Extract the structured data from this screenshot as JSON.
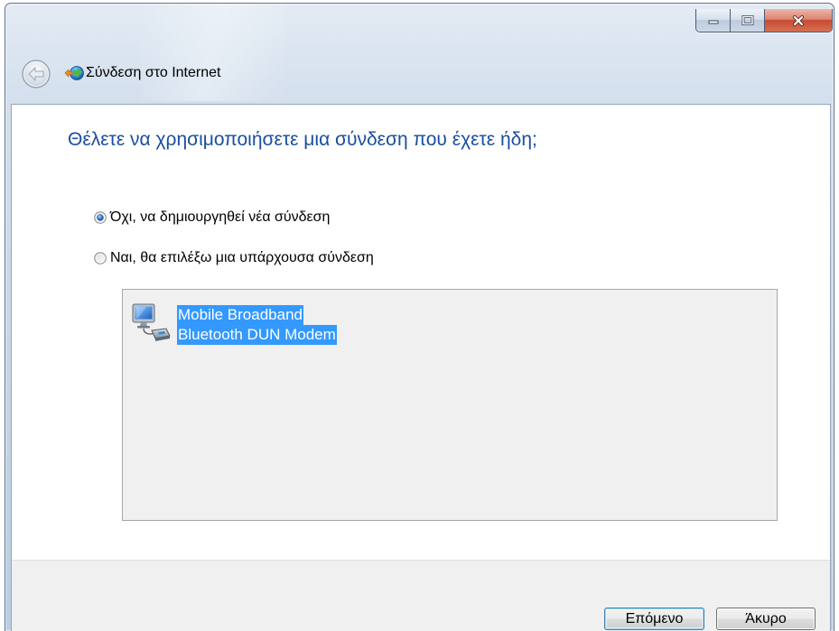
{
  "window": {
    "title": "Σύνδεση στο Internet",
    "app_icon": "connect-internet-icon",
    "back_icon": "back-arrow-icon",
    "controls": {
      "minimize_icon": "minimize-icon",
      "maximize_icon": "maximize-icon",
      "close_icon": "close-icon"
    }
  },
  "main": {
    "heading": "Θέλετε να χρησιμοποιήσετε μια σύνδεση που έχετε ήδη;",
    "options": [
      {
        "label": "Όχι, να δημιουργηθεί νέα σύνδεση",
        "checked": true
      },
      {
        "label": "Ναι, θα επιλέξω μια υπάρχουσα σύνδεση",
        "checked": false
      }
    ],
    "connections": [
      {
        "label_lines": [
          "Mobile Broadband",
          "Bluetooth DUN Modem"
        ],
        "icon": "mobile-broadband-icon",
        "selected": true
      }
    ]
  },
  "buttons": {
    "next": "Επόμενο",
    "cancel": "Άκυρο"
  },
  "colors": {
    "heading": "#1a4ea0",
    "selection": "#3399ff",
    "command_bar": "#f0f0f0",
    "list_background": "#f0f0f0"
  }
}
